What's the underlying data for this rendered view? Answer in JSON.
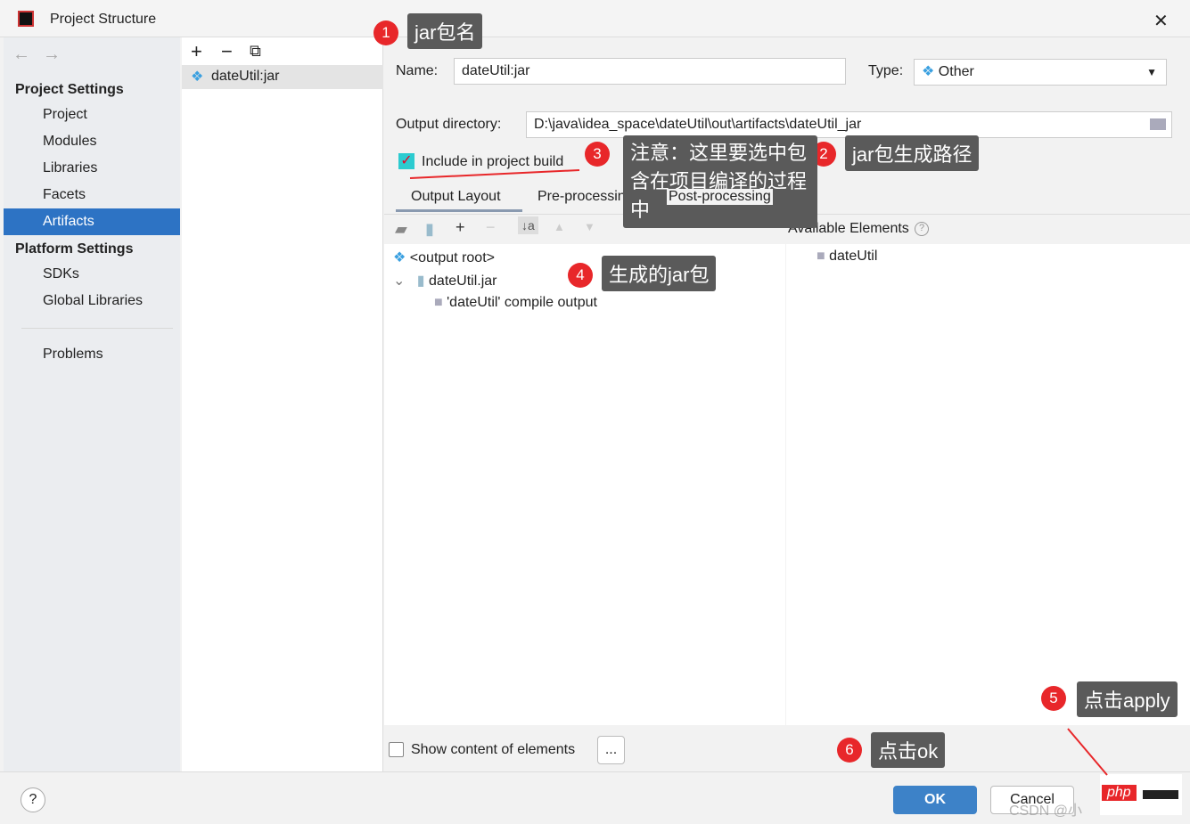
{
  "window": {
    "title": "Project Structure",
    "close": "✕"
  },
  "sidebar": {
    "back": "←",
    "forward": "→",
    "project_settings": "Project Settings",
    "items": [
      "Project",
      "Modules",
      "Libraries",
      "Facets",
      "Artifacts"
    ],
    "platform_settings": "Platform Settings",
    "platform_items": [
      "SDKs",
      "Global Libraries"
    ],
    "problems": "Problems"
  },
  "artifacts": {
    "add": "+",
    "remove": "−",
    "copy": "⧉",
    "items": [
      "dateUtil:jar"
    ]
  },
  "form": {
    "name_label": "Name:",
    "name_value": "dateUtil:jar",
    "type_label": "Type:",
    "type_value": "Other",
    "output_label": "Output directory:",
    "output_value": "D:\\java\\idea_space\\dateUtil\\out\\artifacts\\dateUtil_jar",
    "include_label": "Include in project build",
    "include_checked": true
  },
  "tabs": [
    "Output Layout",
    "Pre-processing",
    "Post-processing"
  ],
  "tree": {
    "root": "<output root>",
    "jar": "dateUtil.jar",
    "compile": "'dateUtil' compile output"
  },
  "available": {
    "label": "Available Elements",
    "items": [
      "dateUtil"
    ]
  },
  "show_content": "Show content of elements",
  "ellipsis": "...",
  "footer": {
    "help": "?",
    "ok": "OK",
    "cancel": "Cancel"
  },
  "annotations": [
    {
      "n": "1",
      "text": "jar包名"
    },
    {
      "n": "2",
      "text": "jar包生成路径"
    },
    {
      "n": "3",
      "text": "注意：这里要选中包含在项目编译的过程中"
    },
    {
      "n": "4",
      "text": "生成的jar包"
    },
    {
      "n": "5",
      "text": "点击apply"
    },
    {
      "n": "6",
      "text": "点击ok"
    }
  ],
  "watermark": {
    "csdn": "CSDN @小",
    "php": "php"
  }
}
